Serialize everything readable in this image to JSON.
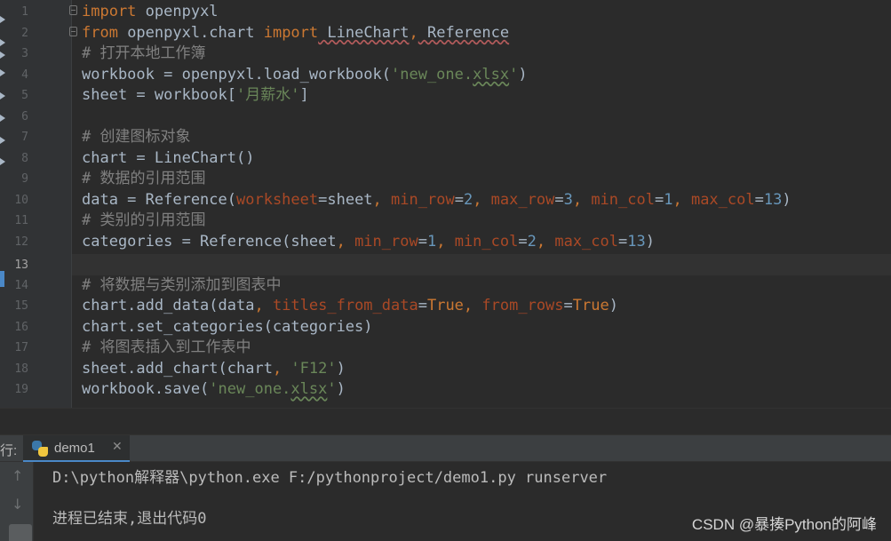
{
  "editor": {
    "line_numbers": [
      "1",
      "2",
      "3",
      "4",
      "5",
      "6",
      "7",
      "8",
      "9",
      "10",
      "11",
      "12",
      "13",
      "14",
      "15",
      "16",
      "17",
      "18",
      "19"
    ],
    "current_line": "13",
    "lines": {
      "l1": {
        "kw": "import",
        "rest": " openpyxl"
      },
      "l2": {
        "kw1": "from",
        "mod": " openpyxl.chart ",
        "kw2": "import",
        "cls1": " LineChart",
        "comma": ",",
        "cls2": " Reference"
      },
      "l3": {
        "comment": "# 打开本地工作簿"
      },
      "l4": {
        "a": "workbook = openpyxl.load_workbook(",
        "s1": "'new_one.",
        "s2": "xlsx",
        "s3": "'",
        "b": ")"
      },
      "l5": {
        "a": "sheet = workbook[",
        "s": "'月薪水'",
        "b": "]"
      },
      "l7": {
        "comment": "# 创建图标对象"
      },
      "l8": {
        "code": "chart = LineChart()"
      },
      "l9": {
        "comment": "# 数据的引用范围"
      },
      "l10": {
        "a": "data = Reference(",
        "p1": "worksheet",
        "e1": "=sheet",
        "c1": ", ",
        "p2": "min_row",
        "e2": "=",
        "n2": "2",
        "c2": ", ",
        "p3": "max_row",
        "e3": "=",
        "n3": "3",
        "c3": ", ",
        "p4": "min_col",
        "e4": "=",
        "n4": "1",
        "c4": ", ",
        "p5": "max_col",
        "e5": "=",
        "n5": "13",
        "b": ")"
      },
      "l11": {
        "comment": "# 类别的引用范围"
      },
      "l12": {
        "a": "categories = Reference(sheet",
        "c1": ", ",
        "p1": "min_row",
        "e1": "=",
        "n1": "1",
        "c2": ", ",
        "p2": "min_col",
        "e2": "=",
        "n2": "2",
        "c3": ", ",
        "p3": "max_col",
        "e3": "=",
        "n3": "13",
        "b": ")"
      },
      "l14": {
        "comment": "# 将数据与类别添加到图表中"
      },
      "l15": {
        "a": "chart.add_data(data",
        "c1": ", ",
        "p1": "titles_from_data",
        "e1": "=",
        "k1": "True",
        "c2": ", ",
        "p2": "from_rows",
        "e2": "=",
        "k2": "True",
        "b": ")"
      },
      "l16": {
        "code": "chart.set_categories(categories)"
      },
      "l17": {
        "comment": "# 将图表插入到工作表中"
      },
      "l18": {
        "a": "sheet.add_chart(chart",
        "c1": ", ",
        "s": "'F12'",
        "b": ")"
      },
      "l19": {
        "a": "workbook.save(",
        "s1": "'new_one.",
        "s2": "xlsx",
        "s3": "'",
        "b": ")"
      }
    }
  },
  "run_panel": {
    "label": "行:",
    "tab_label": "demo1",
    "output": [
      "D:\\python解释器\\python.exe F:/pythonproject/demo1.py runserver",
      "进程已结束,退出代码0"
    ]
  },
  "watermark": "CSDN @暴揍Python的阿峰",
  "colors": {
    "background": "#2b2b2b",
    "keyword": "#cc7832",
    "comment": "#808080",
    "string": "#6a8759",
    "number": "#6897bb",
    "parameter": "#aa4926",
    "text": "#a9b7c6"
  },
  "icons": [
    "python-file-icon",
    "scroll-up-icon",
    "scroll-down-icon",
    "soft-wrap-icon",
    "fold-icon"
  ]
}
